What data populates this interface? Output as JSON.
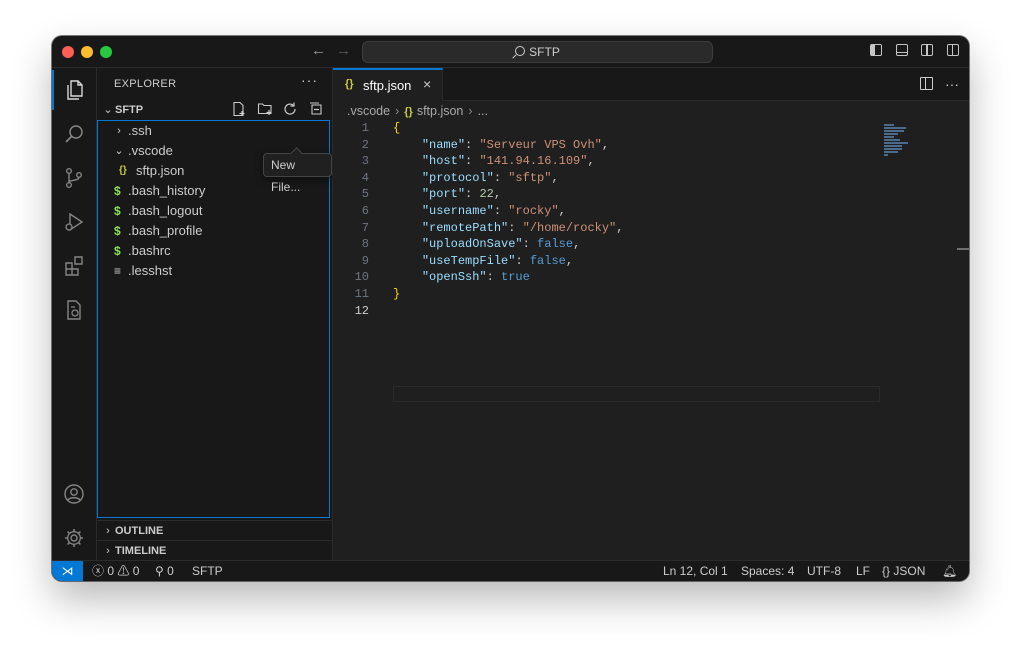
{
  "window": {
    "search_label": "SFTP"
  },
  "sidebar": {
    "title": "EXPLORER",
    "more_label": "···",
    "section_title": "SFTP",
    "tooltip": "New File...",
    "tree": [
      {
        "label": ".ssh",
        "type": "folder",
        "expanded": false,
        "depth": 0
      },
      {
        "label": ".vscode",
        "type": "folder",
        "expanded": true,
        "depth": 0
      },
      {
        "label": "sftp.json",
        "type": "json",
        "icon": "{}",
        "depth": 1
      },
      {
        "label": ".bash_history",
        "type": "shell",
        "icon": "$",
        "depth": 0
      },
      {
        "label": ".bash_logout",
        "type": "shell",
        "icon": "$",
        "depth": 0
      },
      {
        "label": ".bash_profile",
        "type": "shell",
        "icon": "$",
        "depth": 0
      },
      {
        "label": ".bashrc",
        "type": "shell",
        "icon": "$",
        "depth": 0
      },
      {
        "label": ".lesshst",
        "type": "text",
        "icon": "≡",
        "depth": 0
      }
    ],
    "outline_label": "OUTLINE",
    "timeline_label": "TIMELINE"
  },
  "editor": {
    "tab_label": "sftp.json",
    "tab_icon": "{}",
    "close_label": "×",
    "breadcrumb": [
      ".vscode",
      "sftp.json",
      "..."
    ],
    "lines": [
      {
        "num": "1"
      },
      {
        "num": "2",
        "key": "\"name\"",
        "val": "\"Serveur VPS Ovh\"",
        "kind": "string"
      },
      {
        "num": "3",
        "key": "\"host\"",
        "val": "\"141.94.16.109\"",
        "kind": "string"
      },
      {
        "num": "4",
        "key": "\"protocol\"",
        "val": "\"sftp\"",
        "kind": "string"
      },
      {
        "num": "5",
        "key": "\"port\"",
        "val": "22",
        "kind": "number"
      },
      {
        "num": "6",
        "key": "\"username\"",
        "val": "\"rocky\"",
        "kind": "string"
      },
      {
        "num": "7",
        "key": "\"remotePath\"",
        "val": "\"/home/rocky\"",
        "kind": "string"
      },
      {
        "num": "8",
        "key": "\"uploadOnSave\"",
        "val": "false",
        "kind": "bool"
      },
      {
        "num": "9",
        "key": "\"useTempFile\"",
        "val": "false",
        "kind": "bool"
      },
      {
        "num": "10",
        "key": "\"openSsh\"",
        "val": "true",
        "kind": "bool"
      },
      {
        "num": "11"
      },
      {
        "num": "12"
      }
    ]
  },
  "status": {
    "errors": "0",
    "warnings": "0",
    "ports": "0",
    "sftp_label": "SFTP",
    "position": "Ln 12, Col 1",
    "spaces": "Spaces: 4",
    "encoding": "UTF-8",
    "eol": "LF",
    "language_icon": "{}",
    "language": "JSON"
  },
  "colors": {
    "accent": "#0078d4",
    "json_icon": "#cbcb41",
    "shell_icon": "#89e051",
    "key": "#9cdcfe",
    "string": "#ce9178",
    "number": "#b5cea8",
    "boolean": "#569cd6",
    "bracket": "#ffd700"
  }
}
